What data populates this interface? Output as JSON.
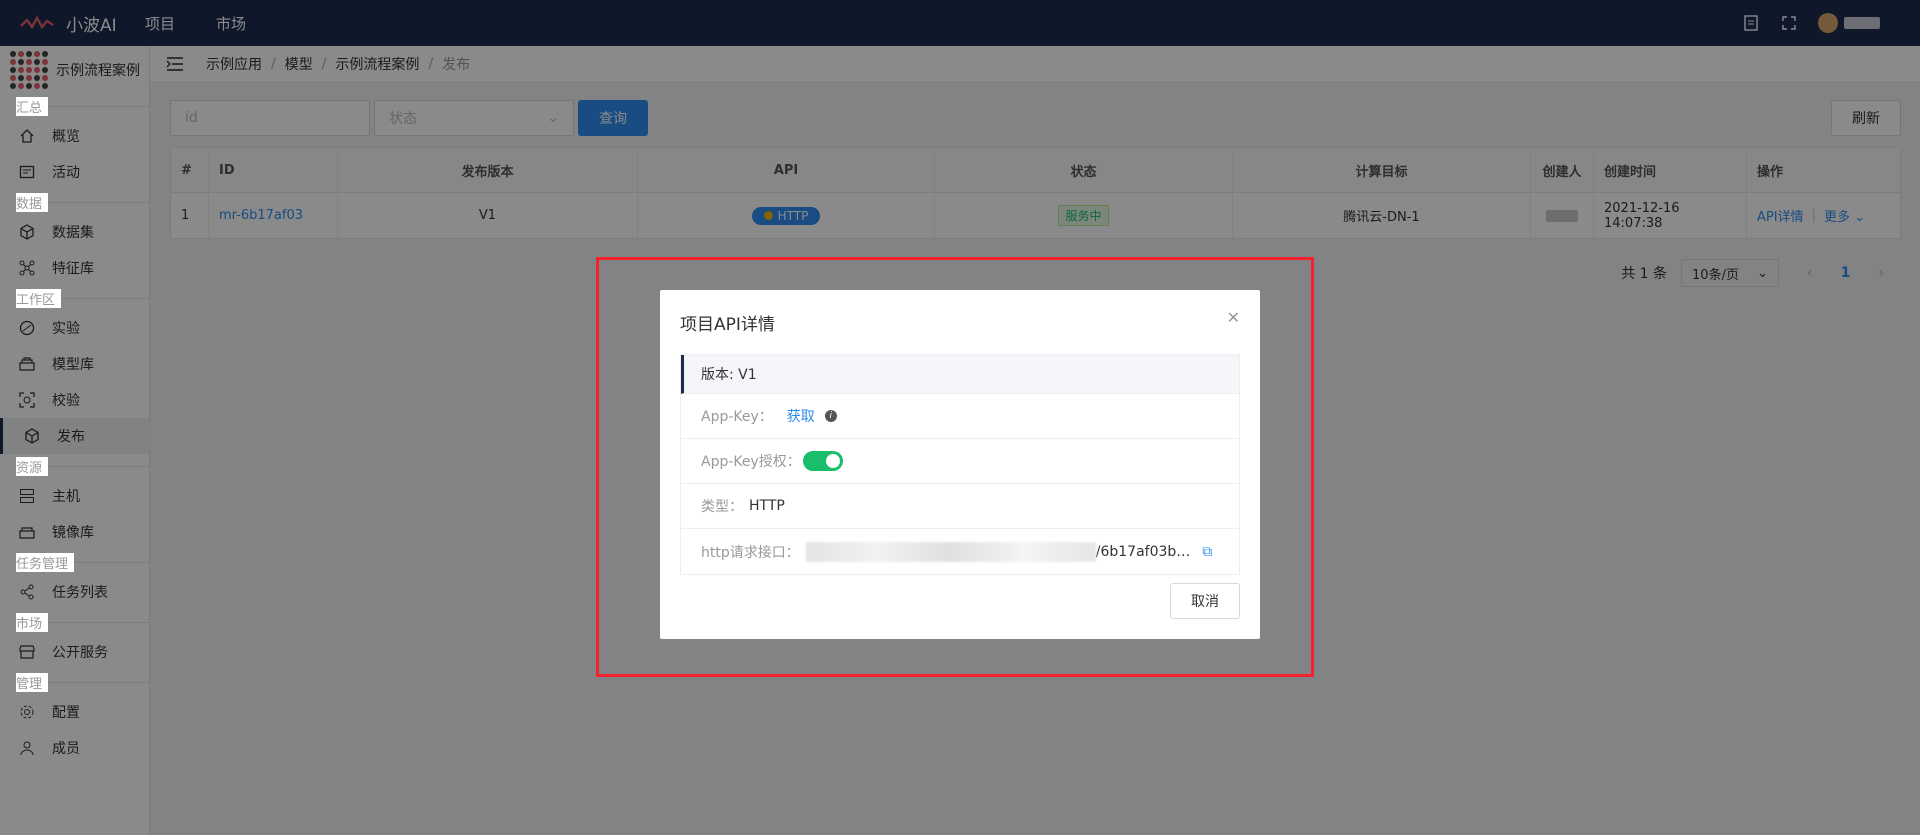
{
  "app": {
    "name": "小波AI"
  },
  "topnav": [
    {
      "label": "项目"
    },
    {
      "label": "市场"
    }
  ],
  "project": {
    "name": "示例流程案例"
  },
  "sidebar": {
    "groups": [
      {
        "label": "汇总",
        "items": [
          {
            "label": "概览",
            "icon": "home-icon"
          },
          {
            "label": "活动",
            "icon": "activity-icon"
          }
        ]
      },
      {
        "label": "数据",
        "items": [
          {
            "label": "数据集",
            "icon": "cube-icon"
          },
          {
            "label": "特征库",
            "icon": "network-icon"
          }
        ]
      },
      {
        "label": "工作区",
        "items": [
          {
            "label": "实验",
            "icon": "experiment-icon"
          },
          {
            "label": "模型库",
            "icon": "model-icon"
          },
          {
            "label": "校验",
            "icon": "scan-icon"
          },
          {
            "label": "发布",
            "icon": "box-icon",
            "active": true
          }
        ]
      },
      {
        "label": "资源",
        "items": [
          {
            "label": "主机",
            "icon": "server-icon"
          },
          {
            "label": "镜像库",
            "icon": "image-icon"
          }
        ]
      },
      {
        "label": "任务管理",
        "items": [
          {
            "label": "任务列表",
            "icon": "share-icon"
          }
        ]
      },
      {
        "label": "市场",
        "items": [
          {
            "label": "公开服务",
            "icon": "store-icon"
          }
        ]
      },
      {
        "label": "管理",
        "items": [
          {
            "label": "配置",
            "icon": "gear-icon"
          },
          {
            "label": "成员",
            "icon": "user-icon"
          }
        ]
      }
    ]
  },
  "breadcrumb": [
    "示例应用",
    "模型",
    "示例流程案例",
    "发布"
  ],
  "filters": {
    "id_placeholder": "id",
    "status_placeholder": "状态",
    "query_label": "查询",
    "refresh_label": "刷新"
  },
  "table": {
    "headers": [
      "#",
      "ID",
      "发布版本",
      "API",
      "状态",
      "计算目标",
      "创建人",
      "创建时间",
      "操作"
    ],
    "rows": [
      {
        "index": "1",
        "id": "mr-6b17af03",
        "version": "V1",
        "api": "HTTP",
        "status": "服务中",
        "target": "腾讯云-DN-1",
        "created": "2021-12-16 14:07:38",
        "op_detail": "API详情",
        "op_more": "更多"
      }
    ]
  },
  "pagination": {
    "total": "共 1 条",
    "page_size": "10条/页",
    "current": "1"
  },
  "modal": {
    "title": "项目API详情",
    "version": "版本: V1",
    "appkey_label": "App-Key：",
    "appkey_link": "获取",
    "appkey_auth_label": "App-Key授权：",
    "appkey_auth_on": true,
    "type_label": "类型：",
    "type_value": "HTTP",
    "http_label": "http请求接口：",
    "http_tail": "/6b17af03b…",
    "cancel": "取消"
  },
  "colors": {
    "topbar": "#1c2b4f",
    "primary": "#2d8cf0",
    "success": "#19be6b",
    "highlight": "#f5222d"
  }
}
